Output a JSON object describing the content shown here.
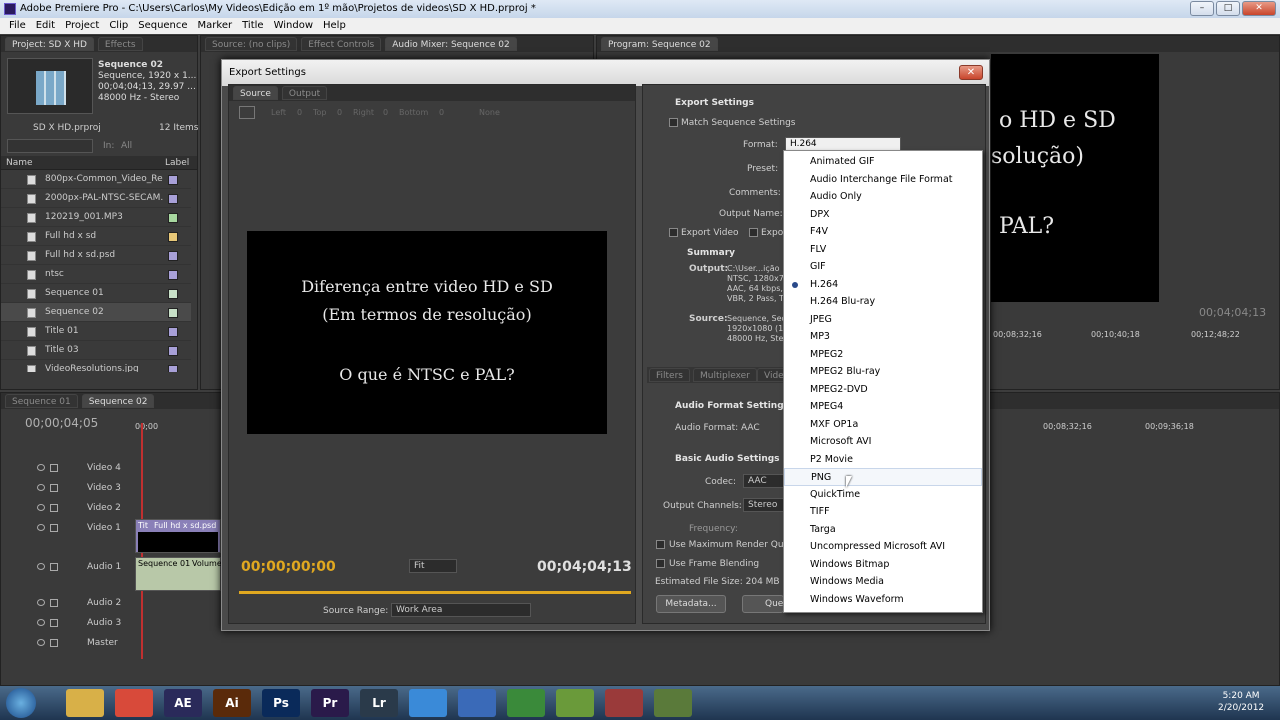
{
  "app": {
    "title": "Adobe Premiere Pro - C:\\Users\\Carlos\\My Videos\\Edição em 1º mão\\Projetos de videos\\SD X HD.prproj *",
    "menu": [
      "File",
      "Edit",
      "Project",
      "Clip",
      "Sequence",
      "Marker",
      "Title",
      "Window",
      "Help"
    ],
    "win_min": "–",
    "win_max": "□",
    "win_close": "✕"
  },
  "project": {
    "tabs": [
      "Project: SD X HD",
      "Effects"
    ],
    "thumb_title": "Sequence 02",
    "thumb_lines": [
      "Sequence, 1920 x 1...",
      "00;04;04;13, 29.97 ...",
      "48000 Hz - Stereo"
    ],
    "project_name": "SD X HD.prproj",
    "item_count": "12 Items",
    "search_in": "In:",
    "search_scope": "All",
    "col_name": "Name",
    "col_label": "Label",
    "items": [
      {
        "name": "800px-Common_Video_Re",
        "color": "#a8a0d8"
      },
      {
        "name": "2000px-PAL-NTSC-SECAM.",
        "color": "#a8a0d8"
      },
      {
        "name": "120219_001.MP3",
        "color": "#a8d8a0"
      },
      {
        "name": "Full hd x sd",
        "color": "#e8c878"
      },
      {
        "name": "Full hd x sd.psd",
        "color": "#a8a0d8"
      },
      {
        "name": "ntsc",
        "color": "#a8a0d8"
      },
      {
        "name": "Sequence 01",
        "color": "#c8e0c8"
      },
      {
        "name": "Sequence 02",
        "color": "#c8e0c8"
      },
      {
        "name": "Title 01",
        "color": "#a8a0d8"
      },
      {
        "name": "Title 03",
        "color": "#a8a0d8"
      },
      {
        "name": "VideoResolutions.jpg",
        "color": "#a8a0d8"
      }
    ]
  },
  "source_tabs": [
    "Source: (no clips)",
    "Effect Controls",
    "Audio Mixer: Sequence 02"
  ],
  "program": {
    "tab": "Program: Sequence 02",
    "preview_lines": [
      "o HD e SD",
      "solução)",
      "PAL?"
    ],
    "timecode": "00;04;04;13",
    "ruler": [
      "00;08;32;16",
      "00;10;40;18",
      "00;12;48;22"
    ]
  },
  "timeline": {
    "tabs": [
      "Sequence 01",
      "Sequence 02"
    ],
    "timecode": "00;00;04;05",
    "ruler_start": "00;00",
    "ruler_right": [
      "00;08;32;16",
      "00;09;36;18"
    ],
    "tracks": [
      "Video 4",
      "Video 3",
      "Video 2",
      "Video 1",
      "Audio 1",
      "Audio 2",
      "Audio 3",
      "Master"
    ],
    "clip_title": "Tit",
    "clip_name": "Full hd x sd.psd",
    "audio_clip": "Sequence 01",
    "audio_clip_label": "Volume"
  },
  "export": {
    "title": "Export Settings",
    "close": "✕",
    "tabs": [
      "Source",
      "Output"
    ],
    "crop": {
      "left": "Left",
      "top": "Top",
      "right": "Right",
      "bottom": "Bottom",
      "zero": "0",
      "none": "None"
    },
    "preview_lines": [
      "Diferença entre video HD e SD",
      "(Em termos de resolução)",
      "O que é NTSC e PAL?"
    ],
    "tc_in": "00;00;00;00",
    "tc_out": "00;04;04;13",
    "fit": "Fit",
    "source_range_label": "Source Range:",
    "source_range_value": "Work Area",
    "settings": {
      "section": "Export Settings",
      "match": "Match Sequence Settings",
      "format_label": "Format:",
      "format_value": "H.264",
      "preset_label": "Preset:",
      "comments_label": "Comments:",
      "output_label": "Output Name:",
      "export_video": "Export Video",
      "export_audio": "Export Audio",
      "summary": "Summary",
      "output_key": "Output:",
      "output_lines": [
        "C:\\User...ição",
        "NTSC, 1280x72",
        "AAC, 64 kbps,",
        "VBR, 2 Pass, T"
      ],
      "source_key": "Source:",
      "source_lines": [
        "Sequence, Seq",
        "1920x1080 (1.0",
        "48000 Hz, Ster"
      ]
    },
    "subtabs": [
      "Filters",
      "Multiplexer",
      "Video"
    ],
    "audio": {
      "section1": "Audio Format Settings",
      "format_label": "Audio Format:",
      "format_value": "AAC",
      "section2": "Basic Audio Settings",
      "codec_label": "Codec:",
      "codec_value": "AAC",
      "channels_label": "Output Channels:",
      "channels_value": "Stereo",
      "freq_label": "Frequency:"
    },
    "max_render": "Use Maximum Render Quality",
    "frame_blend": "Use Frame Blending",
    "file_size": "Estimated File Size: 204 MB",
    "metadata_btn": "Metadata...",
    "queue_btn": "Queue"
  },
  "format_dropdown": {
    "selected": "H.264",
    "hovered": "PNG",
    "items": [
      "Animated GIF",
      "Audio Interchange File Format",
      "Audio Only",
      "DPX",
      "F4V",
      "FLV",
      "GIF",
      "H.264",
      "H.264 Blu-ray",
      "JPEG",
      "MP3",
      "MPEG2",
      "MPEG2 Blu-ray",
      "MPEG2-DVD",
      "MPEG4",
      "MXF OP1a",
      "Microsoft AVI",
      "P2 Movie",
      "PNG",
      "QuickTime",
      "TIFF",
      "Targa",
      "Uncompressed Microsoft AVI",
      "Windows Bitmap",
      "Windows Media",
      "Windows Waveform"
    ]
  },
  "taskbar": {
    "apps": [
      {
        "name": "explorer",
        "label": "",
        "color": "#d8b048"
      },
      {
        "name": "chrome",
        "label": "",
        "color": "#d84a3a"
      },
      {
        "name": "after-effects",
        "label": "AE",
        "color": "#2a2a5a"
      },
      {
        "name": "illustrator",
        "label": "Ai",
        "color": "#5a2a0a"
      },
      {
        "name": "photoshop",
        "label": "Ps",
        "color": "#0a2a5a"
      },
      {
        "name": "premiere",
        "label": "Pr",
        "color": "#2a1a4a"
      },
      {
        "name": "lightroom",
        "label": "Lr",
        "color": "#2a3a4a"
      },
      {
        "name": "skype",
        "label": "",
        "color": "#3a8ad8"
      },
      {
        "name": "itunes",
        "label": "",
        "color": "#3a6ab8"
      },
      {
        "name": "utorrent",
        "label": "",
        "color": "#3a8a3a"
      },
      {
        "name": "app-green",
        "label": "",
        "color": "#6a9a3a"
      },
      {
        "name": "app-media",
        "label": "",
        "color": "#9a3a3a"
      },
      {
        "name": "app-tool",
        "label": "",
        "color": "#5a7a3a"
      }
    ],
    "time": "5:20 AM",
    "date": "2/20/2012"
  }
}
